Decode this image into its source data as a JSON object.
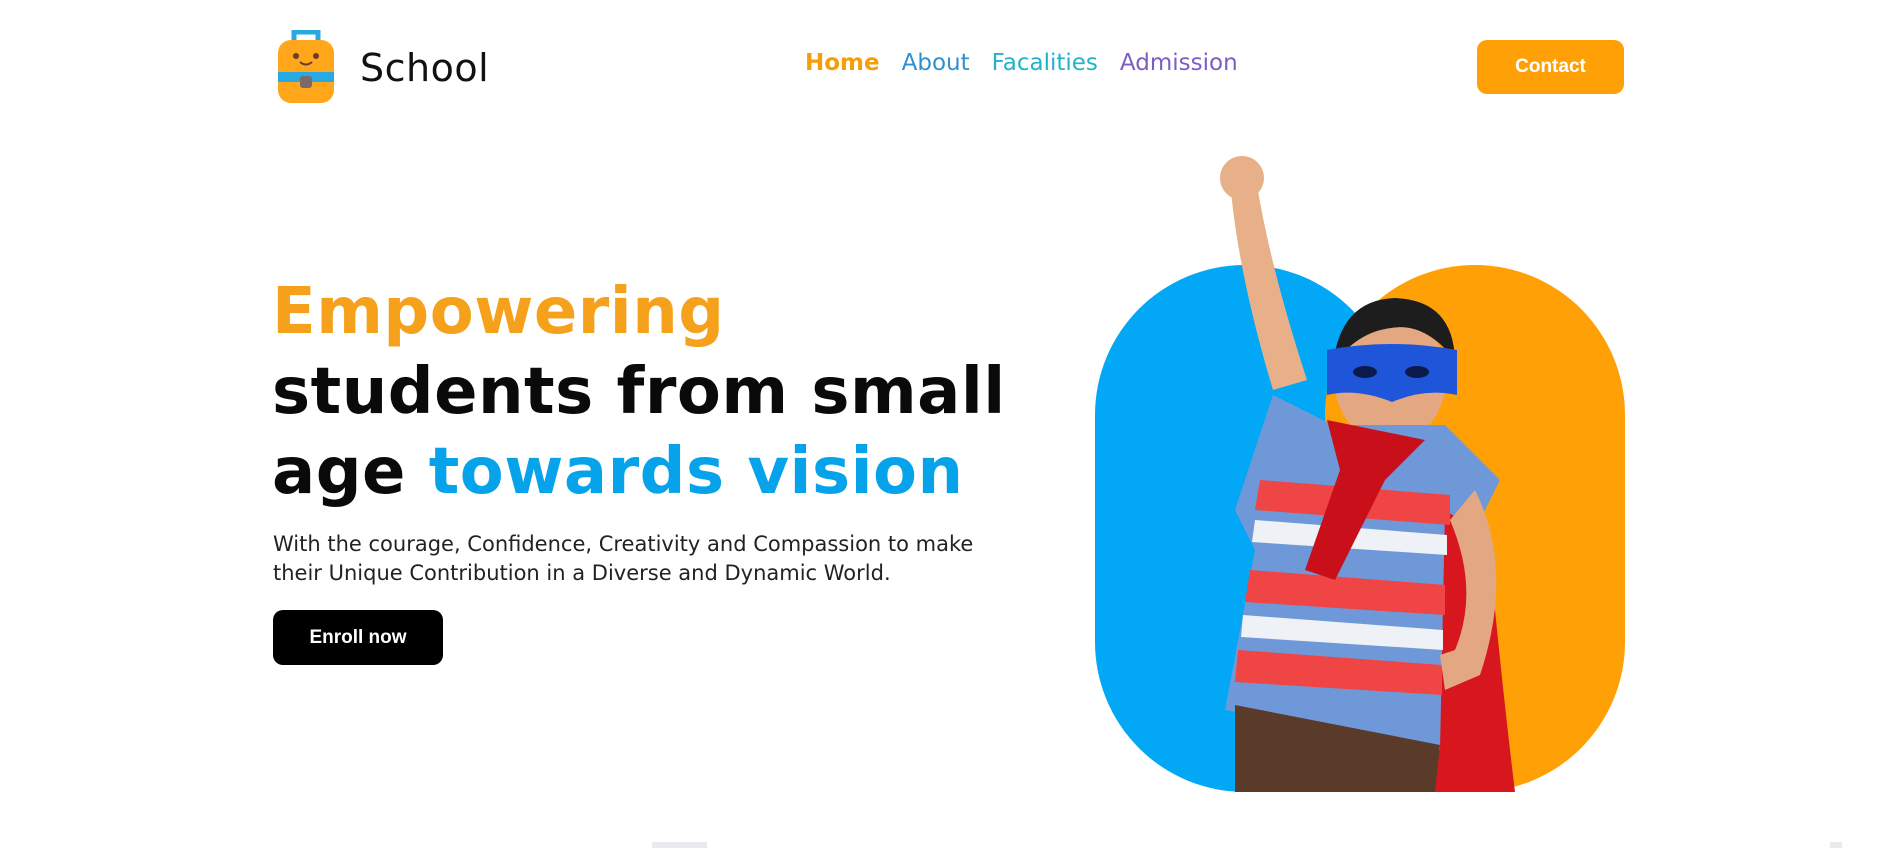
{
  "brand": {
    "name": "School"
  },
  "nav": {
    "items": [
      {
        "label": "Home",
        "active": true
      },
      {
        "label": "About"
      },
      {
        "label": "Facalities"
      },
      {
        "label": "Admission"
      }
    ]
  },
  "header": {
    "contact_label": "Contact"
  },
  "hero": {
    "title_part1": "Empowering",
    "title_part2": "students from small",
    "title_part3": "age ",
    "title_part4": "towards vision",
    "description_line1": "With the courage, Confidence, Creativity and Compassion to make",
    "description_line2": "their Unique Contribution in a Diverse and Dynamic World.",
    "enroll_label": "Enroll now"
  },
  "colors": {
    "accent_orange": "#ffa007",
    "accent_blue": "#02a8f5",
    "nav_home": "#f59e0b",
    "nav_about": "#2f8fcf",
    "nav_facilities": "#22b3c7",
    "nav_admission": "#7a5fc0"
  },
  "icons": {
    "logo": "backpack-icon",
    "hero_image": "superhero-kid-illustration"
  }
}
